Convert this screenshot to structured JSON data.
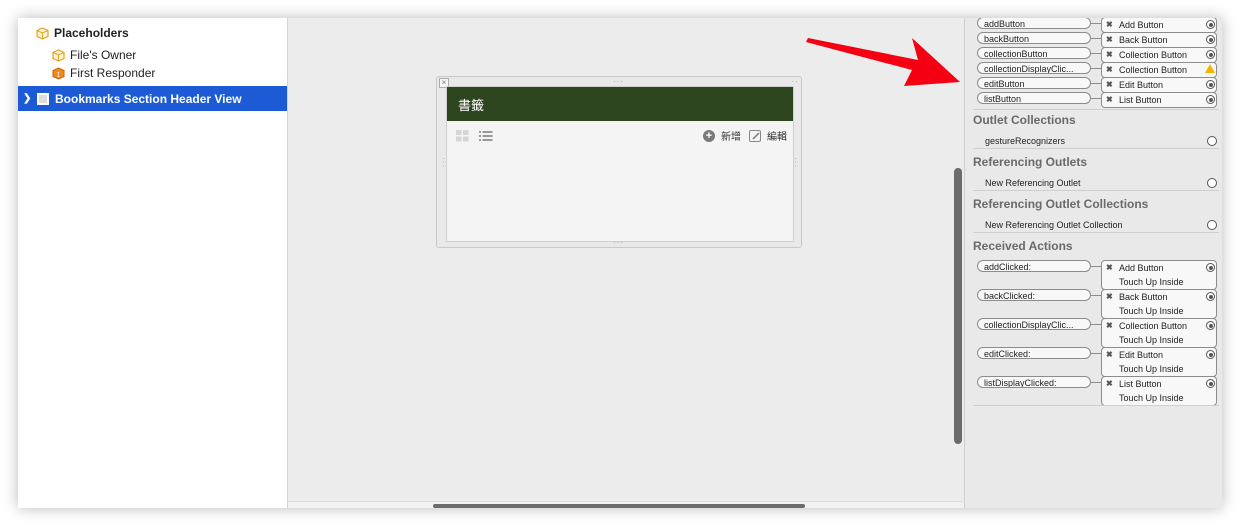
{
  "outline": {
    "group_label": "Placeholders",
    "items": [
      {
        "label": "File's Owner"
      },
      {
        "label": "First Responder"
      }
    ],
    "selected_label": "Bookmarks Section Header View"
  },
  "canvas": {
    "header_title": "書籤",
    "add_label": "新增",
    "edit_label": "編輯"
  },
  "inspector": {
    "outlets": [
      {
        "name": "addButton",
        "target": "Add Button",
        "status": "ok"
      },
      {
        "name": "backButton",
        "target": "Back Button",
        "status": "ok"
      },
      {
        "name": "collectionButton",
        "target": "Collection Button",
        "status": "ok"
      },
      {
        "name": "collectionDisplayClic...",
        "target": "Collection Button",
        "status": "warning"
      },
      {
        "name": "editButton",
        "target": "Edit Button",
        "status": "ok"
      },
      {
        "name": "listButton",
        "target": "List Button",
        "status": "ok"
      }
    ],
    "outlet_collections": {
      "title": "Outlet Collections",
      "row": "gestureRecognizers"
    },
    "referencing_outlets": {
      "title": "Referencing Outlets",
      "row": "New Referencing Outlet"
    },
    "referencing_outlet_collections": {
      "title": "Referencing Outlet Collections",
      "row": "New Referencing Outlet Collection"
    },
    "received_actions": {
      "title": "Received Actions",
      "items": [
        {
          "name": "addClicked:",
          "target": "Add Button",
          "event": "Touch Up Inside"
        },
        {
          "name": "backClicked:",
          "target": "Back Button",
          "event": "Touch Up Inside"
        },
        {
          "name": "collectionDisplayClic...",
          "target": "Collection Button",
          "event": "Touch Up Inside"
        },
        {
          "name": "editClicked:",
          "target": "Edit Button",
          "event": "Touch Up Inside"
        },
        {
          "name": "listDisplayClicked:",
          "target": "List Button",
          "event": "Touch Up Inside"
        }
      ]
    }
  },
  "colors": {
    "selection": "#1d5bd6",
    "header_green": "#2d4620",
    "arrow_red": "#f40012",
    "warning": "#f4b400"
  }
}
